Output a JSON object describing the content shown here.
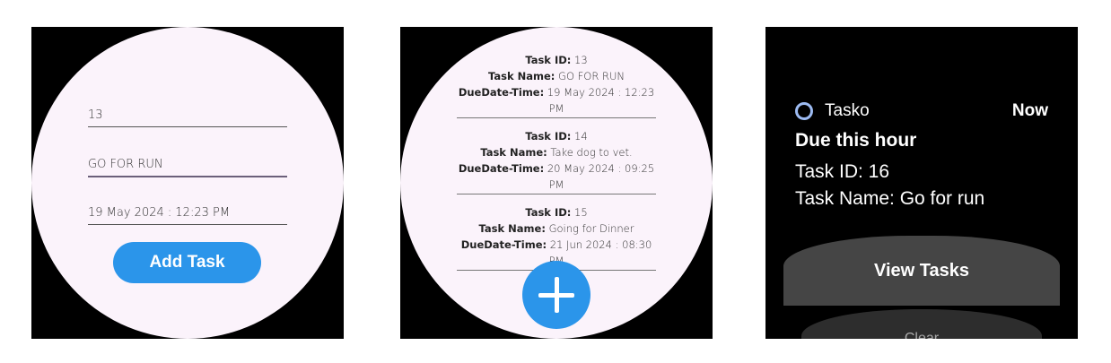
{
  "form": {
    "task_id": "13",
    "task_name": "GO FOR RUN",
    "due_datetime": "19 May 2024 : 12:23 PM",
    "add_button": "Add Task"
  },
  "list": {
    "id_label": "Task ID:",
    "name_label": "Task Name:",
    "due_label": "DueDate-Time:",
    "tasks": [
      {
        "id": "13",
        "name": "GO FOR RUN",
        "due": "19 May 2024 : 12:23 PM"
      },
      {
        "id": "14",
        "name": "Take dog to vet.",
        "due": "20 May 2024 : 09:25 PM"
      },
      {
        "id": "15",
        "name": "Going for Dinner",
        "due": "21 Jun 2024 : 08:30 PM"
      }
    ],
    "fab_icon": "plus-icon"
  },
  "notification": {
    "app_name": "Tasko",
    "time": "Now",
    "title": "Due this hour",
    "line1": "Task ID: 16",
    "line2": "Task Name: Go for run",
    "view_button": "View Tasks",
    "clear_button": "Clear"
  },
  "colors": {
    "accent": "#2b95ea",
    "background": "#fbf3fb",
    "notification_icon": "#9dbbf2"
  }
}
